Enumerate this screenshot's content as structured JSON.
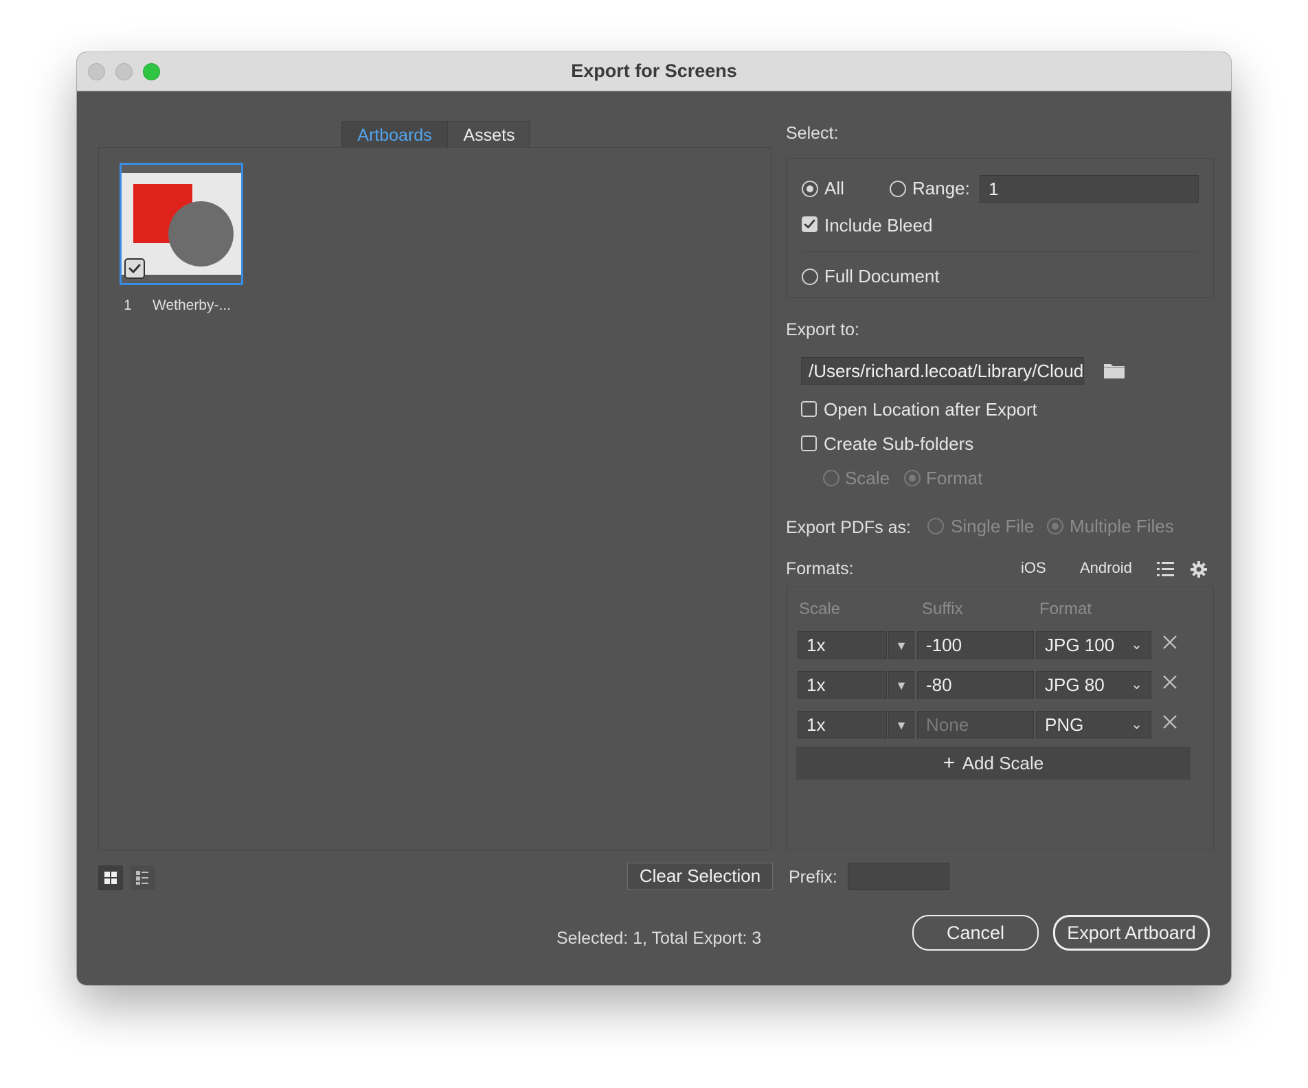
{
  "window": {
    "title": "Export for Screens"
  },
  "tabs": [
    {
      "label": "Artboards",
      "active": true
    },
    {
      "label": "Assets",
      "active": false
    }
  ],
  "artboards": [
    {
      "number": "1",
      "name": "Wetherby-...",
      "checked": true,
      "selected": true
    }
  ],
  "select": {
    "label": "Select:",
    "all_label": "All",
    "range_label": "Range:",
    "range_value": "1",
    "include_bleed_label": "Include Bleed",
    "include_bleed_checked": true,
    "full_document_label": "Full Document",
    "selected_option": "All"
  },
  "export_to": {
    "label": "Export to:",
    "path": "/Users/richard.lecoat/Library/CloudStora",
    "open_location_label": "Open Location after Export",
    "open_location_checked": false,
    "create_subfolders_label": "Create Sub-folders",
    "create_subfolders_checked": false,
    "scale_label": "Scale",
    "format_label": "Format"
  },
  "export_pdfs": {
    "label": "Export PDFs as:",
    "single_label": "Single File",
    "multiple_label": "Multiple Files"
  },
  "formats": {
    "label": "Formats:",
    "ios_label": "iOS",
    "android_label": "Android",
    "columns": {
      "scale": "Scale",
      "suffix": "Suffix",
      "format": "Format"
    },
    "rows": [
      {
        "scale": "1x",
        "suffix": "-100",
        "format": "JPG 100"
      },
      {
        "scale": "1x",
        "suffix": "-80",
        "format": "JPG 80"
      },
      {
        "scale": "1x",
        "suffix": "",
        "suffix_placeholder": "None",
        "format": "PNG"
      }
    ],
    "add_scale_label": "Add Scale"
  },
  "prefix": {
    "label": "Prefix:",
    "value": ""
  },
  "footer": {
    "clear_selection_label": "Clear Selection",
    "status": "Selected: 1, Total Export: 3",
    "cancel_label": "Cancel",
    "export_label": "Export Artboard"
  },
  "icons": {
    "folder": "folder-icon",
    "list": "list-icon",
    "gear": "gear-icon",
    "grid_view": "grid-view-icon",
    "list_view": "list-view-icon"
  },
  "colors": {
    "background": "#535353",
    "accent": "#53a4ec",
    "selection_border": "#3a8de6",
    "artboard_red": "#e0221c",
    "artboard_circle": "#6c6c6c"
  }
}
